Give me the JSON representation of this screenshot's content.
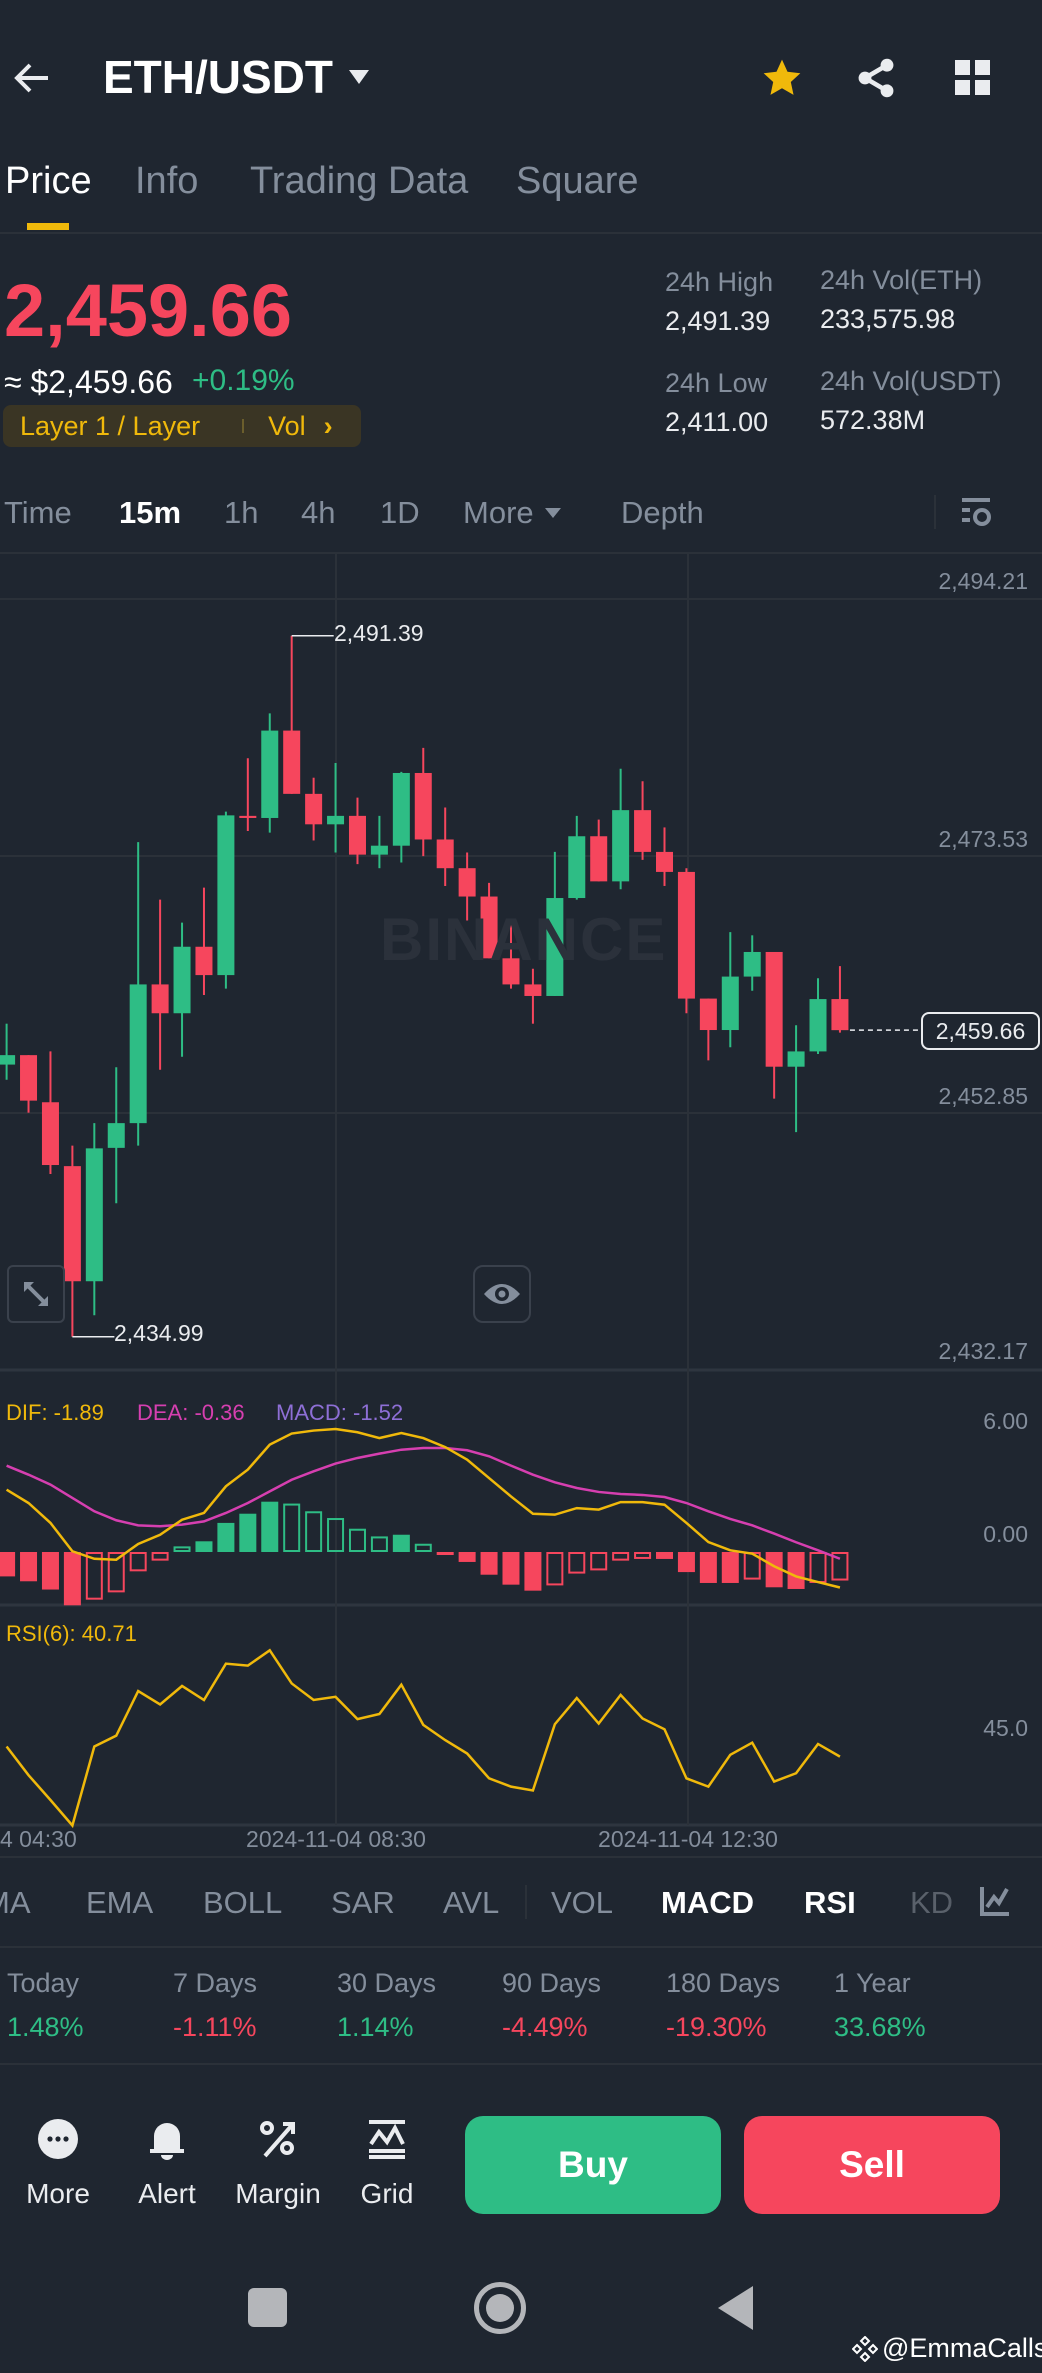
{
  "header": {
    "title": "ETH/USDT",
    "tabs": [
      "Price",
      "Info",
      "Trading Data",
      "Square"
    ],
    "active_tab": "Price"
  },
  "ticker": {
    "price": "2,459.66",
    "usd_price": "≈ $2,459.66",
    "change": "+0.19%",
    "tag_category": "Layer 1 / Layer",
    "tag_vol": "Vol",
    "stats": [
      {
        "label": "24h High",
        "value": "2,491.39"
      },
      {
        "label": "24h Vol(ETH)",
        "value": "233,575.98"
      },
      {
        "label": "24h Low",
        "value": "2,411.00"
      },
      {
        "label": "24h Vol(USDT)",
        "value": "572.38M"
      }
    ]
  },
  "intervals": [
    "Time",
    "15m",
    "1h",
    "4h",
    "1D",
    "More",
    "Depth"
  ],
  "active_interval": "15m",
  "watermark": "BINANCE",
  "colors": {
    "bg": "#1f2630",
    "up": "#2ebd85",
    "down": "#f6465d",
    "accent": "#f0b90b",
    "dif": "#f0b90b",
    "dea": "#d63fb0",
    "macd": "#8e6fd6",
    "rsi": "#f0b90b"
  },
  "chart_data": [
    {
      "type": "candlestick",
      "title": "ETH/USDT 15m",
      "yticks": [
        "2,494.21",
        "2,473.53",
        "2,452.85",
        "2,432.17"
      ],
      "ytick_values": [
        2494.21,
        2473.53,
        2452.85,
        2432.17
      ],
      "high_label": "2,491.39",
      "low_label": "2,434.99",
      "last_label": "2,459.66",
      "high_index": 13,
      "low_index": 3,
      "candles": [
        [
          2456.89,
          2460.18,
          2455.67,
          2457.65
        ],
        [
          2457.65,
          2457.65,
          2453.02,
          2453.99
        ],
        [
          2453.86,
          2457.95,
          2448.09,
          2448.81
        ],
        [
          2448.72,
          2450.37,
          2434.99,
          2439.46
        ],
        [
          2439.46,
          2452.18,
          2436.72,
          2450.15
        ],
        [
          2450.19,
          2456.68,
          2445.73,
          2452.18
        ],
        [
          2452.18,
          2474.79,
          2450.37,
          2463.34
        ],
        [
          2463.34,
          2470.16,
          2456.47,
          2461.02
        ],
        [
          2461.02,
          2468.31,
          2457.52,
          2466.37
        ],
        [
          2466.37,
          2471.13,
          2462.49,
          2464.09
        ],
        [
          2464.09,
          2477.24,
          2463.0,
          2476.94
        ],
        [
          2476.9,
          2481.53,
          2475.68,
          2476.73
        ],
        [
          2476.73,
          2485.15,
          2475.55,
          2483.76
        ],
        [
          2483.76,
          2491.39,
          2478.67,
          2478.67
        ],
        [
          2478.67,
          2479.97,
          2474.92,
          2476.22
        ],
        [
          2476.22,
          2481.15,
          2473.95,
          2476.9
        ],
        [
          2476.9,
          2478.37,
          2473.02,
          2473.78
        ],
        [
          2473.78,
          2476.9,
          2472.69,
          2474.5
        ],
        [
          2474.5,
          2480.44,
          2473.15,
          2480.35
        ],
        [
          2480.35,
          2482.37,
          2473.66,
          2475.0
        ],
        [
          2475.0,
          2477.57,
          2471.26,
          2472.69
        ],
        [
          2472.69,
          2473.95,
          2468.48,
          2470.41
        ],
        [
          2470.41,
          2471.51,
          2465.44,
          2465.44
        ],
        [
          2465.44,
          2468.31,
          2463.0,
          2463.34
        ],
        [
          2463.34,
          2464.6,
          2460.18,
          2462.41
        ],
        [
          2462.41,
          2474.0,
          2462.41,
          2470.29
        ],
        [
          2470.29,
          2476.9,
          2470.16,
          2475.26
        ],
        [
          2475.26,
          2476.6,
          2471.63,
          2471.63
        ],
        [
          2471.63,
          2480.69,
          2471.0,
          2477.36
        ],
        [
          2477.36,
          2479.68,
          2473.36,
          2474.0
        ],
        [
          2474.0,
          2475.97,
          2471.26,
          2472.39
        ],
        [
          2472.39,
          2472.69,
          2461.02,
          2462.2
        ],
        [
          2462.2,
          2462.2,
          2457.23,
          2459.67
        ],
        [
          2459.67,
          2467.55,
          2458.28,
          2463.97
        ],
        [
          2463.97,
          2467.29,
          2462.83,
          2465.95
        ],
        [
          2465.95,
          2465.95,
          2454.15,
          2456.72
        ],
        [
          2456.72,
          2460.05,
          2451.46,
          2457.95
        ],
        [
          2457.95,
          2463.84,
          2457.74,
          2462.16
        ],
        [
          2462.16,
          2464.81,
          2459.46,
          2459.66
        ]
      ]
    },
    {
      "type": "bar",
      "title": "MACD",
      "legend": {
        "dif": "DIF: -1.89",
        "dea": "DEA: -0.36",
        "macd": "MACD: -1.52"
      },
      "yticks": [
        "6.00",
        "0.00"
      ],
      "ylim": [
        -2.9,
        9.5
      ],
      "macd": [
        -1.3,
        -1.56,
        -2.0,
        -2.84,
        -2.54,
        -2.15,
        -1.03,
        -0.46,
        0.3,
        0.57,
        1.55,
        2.04,
        2.68,
        2.58,
        2.17,
        1.81,
        1.24,
        0.83,
        0.92,
        0.44,
        -0.1,
        -0.53,
        -1.21,
        -1.74,
        -2.06,
        -1.78,
        -1.15,
        -0.98,
        -0.46,
        -0.37,
        -0.37,
        -1.07,
        -1.65,
        -1.65,
        -1.47,
        -1.88,
        -1.97,
        -1.65,
        -1.52
      ],
      "dif": [
        3.32,
        2.61,
        1.55,
        0.04,
        -0.36,
        -0.41,
        0.43,
        0.92,
        1.72,
        2.08,
        3.5,
        4.39,
        5.72,
        6.31,
        6.47,
        6.55,
        6.38,
        6.07,
        6.34,
        6.07,
        5.59,
        4.92,
        3.94,
        2.96,
        2.04,
        1.99,
        2.34,
        2.26,
        2.66,
        2.66,
        2.52,
        1.55,
        0.53,
        0.09,
        -0.09,
        -0.76,
        -1.3,
        -1.6,
        -1.89
      ],
      "dea": [
        4.6,
        4.12,
        3.59,
        2.88,
        2.17,
        1.69,
        1.42,
        1.37,
        1.46,
        1.63,
        2.08,
        2.61,
        3.23,
        3.85,
        4.3,
        4.71,
        5.01,
        5.24,
        5.45,
        5.54,
        5.54,
        5.42,
        5.1,
        4.6,
        4.12,
        3.71,
        3.41,
        3.2,
        3.09,
        3.04,
        2.93,
        2.61,
        2.17,
        1.76,
        1.42,
        0.98,
        0.52,
        0.09,
        -0.36
      ]
    },
    {
      "type": "line",
      "title": "RSI(6)",
      "legend": "RSI(6): 40.71",
      "yticks": [
        "45.0"
      ],
      "ylim": [
        30,
        64
      ],
      "values": [
        42.3,
        37.8,
        33.9,
        29.9,
        42.3,
        44.0,
        51.0,
        48.9,
        51.8,
        49.6,
        55.3,
        55.0,
        57.4,
        52.2,
        49.6,
        50.1,
        46.6,
        47.4,
        52.0,
        45.7,
        43.3,
        41.2,
        37.3,
        36.0,
        35.4,
        45.8,
        49.9,
        45.9,
        50.4,
        46.7,
        45.0,
        37.3,
        36.0,
        41.0,
        42.9,
        36.8,
        38.1,
        42.7,
        40.71
      ],
      "xticks": [
        "4 04:30",
        "2024-11-04 08:30",
        "2024-11-04 12:30"
      ]
    }
  ],
  "indicators": [
    "MA",
    "EMA",
    "BOLL",
    "SAR",
    "AVL",
    "VOL",
    "MACD",
    "RSI",
    "KD"
  ],
  "active_indicators": [
    "MACD",
    "RSI"
  ],
  "performance": [
    {
      "label": "Today",
      "value": "1.48%",
      "dir": "up"
    },
    {
      "label": "7 Days",
      "value": "-1.11%",
      "dir": "down"
    },
    {
      "label": "30 Days",
      "value": "1.14%",
      "dir": "up"
    },
    {
      "label": "90 Days",
      "value": "-4.49%",
      "dir": "down"
    },
    {
      "label": "180 Days",
      "value": "-19.30%",
      "dir": "down"
    },
    {
      "label": "1 Year",
      "value": "33.68%",
      "dir": "up"
    }
  ],
  "actions": {
    "more": "More",
    "alert": "Alert",
    "margin": "Margin",
    "grid": "Grid",
    "buy": "Buy",
    "sell": "Sell"
  },
  "credit": "@EmmaCalls"
}
